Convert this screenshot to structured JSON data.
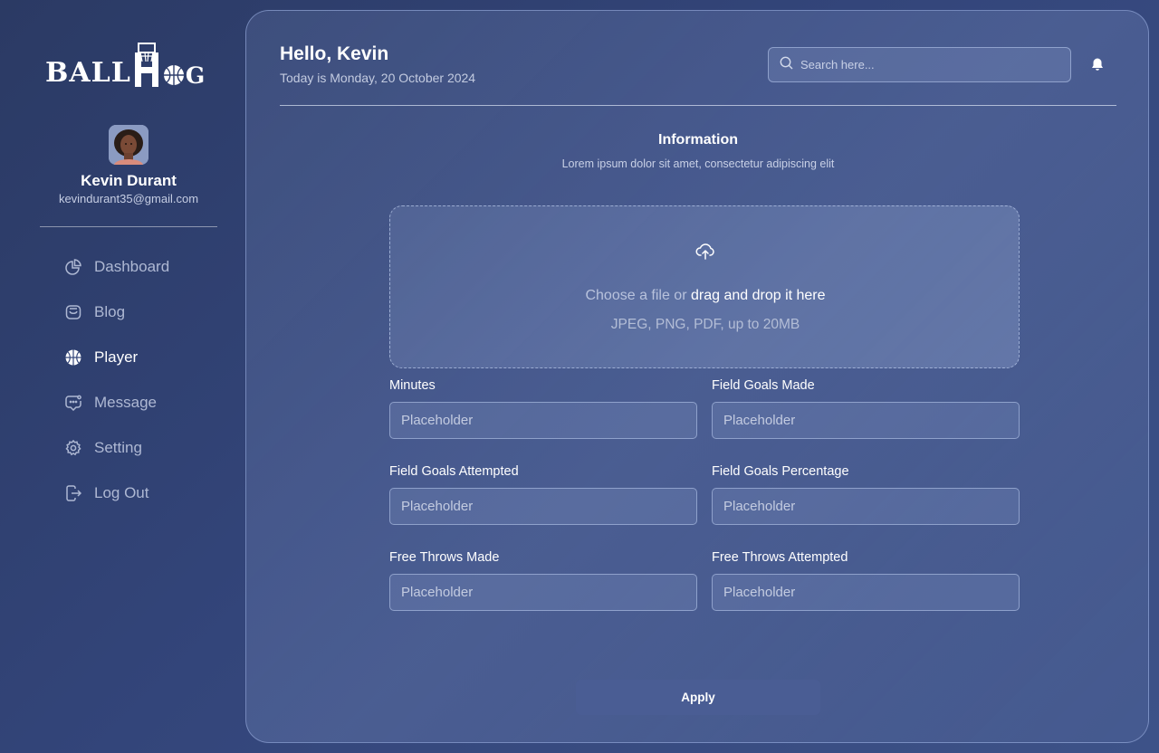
{
  "brand": {
    "logo_text_left": "BALL",
    "logo_text_right": "G"
  },
  "profile": {
    "name": "Kevin Durant",
    "email": "kevindurant35@gmail.com"
  },
  "nav": [
    {
      "label": "Dashboard",
      "icon": "pie-chart-icon",
      "active": false
    },
    {
      "label": "Blog",
      "icon": "blog-icon",
      "active": false
    },
    {
      "label": "Player",
      "icon": "basketball-icon",
      "active": true
    },
    {
      "label": "Message",
      "icon": "message-icon",
      "active": false
    },
    {
      "label": "Setting",
      "icon": "gear-icon",
      "active": false
    },
    {
      "label": "Log Out",
      "icon": "logout-icon",
      "active": false
    }
  ],
  "header": {
    "greeting": "Hello, Kevin",
    "date": "Today is Monday, 20 October 2024",
    "search_placeholder": "Search here..."
  },
  "section": {
    "title": "Information",
    "subtitle": "Lorem ipsum dolor sit amet, consectetur adipiscing elit"
  },
  "upload": {
    "prefix": "Choose a file or",
    "action": "drag and drop it here",
    "hint": "JPEG, PNG, PDF, up to 20MB"
  },
  "fields": [
    {
      "label": "Minutes",
      "placeholder": "Placeholder"
    },
    {
      "label": "Field Goals Made",
      "placeholder": "Placeholder"
    },
    {
      "label": "Field Goals Attempted",
      "placeholder": "Placeholder"
    },
    {
      "label": "Field Goals Percentage",
      "placeholder": "Placeholder"
    },
    {
      "label": "Free Throws Made",
      "placeholder": "Placeholder"
    },
    {
      "label": "Free Throws Attempted",
      "placeholder": "Placeholder"
    }
  ],
  "apply_label": "Apply"
}
